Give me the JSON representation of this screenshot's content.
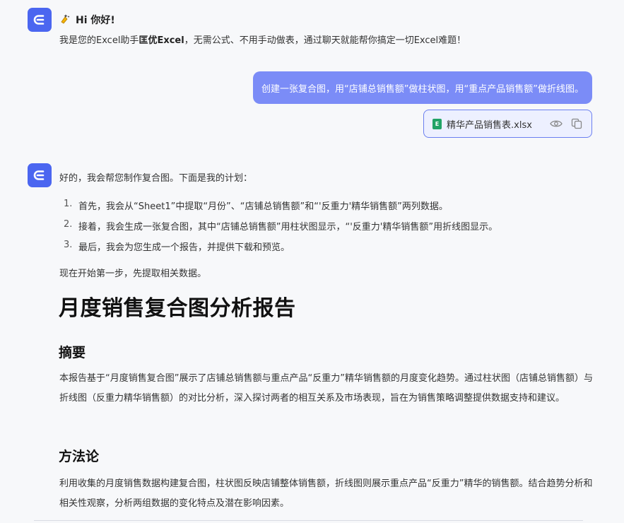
{
  "assistant": {
    "greeting_title": "Hi 你好!",
    "greeting_prefix": "我是您的Excel助手",
    "greeting_brand": "匡优Excel",
    "greeting_suffix": "，无需公式、不用手动做表，通过聊天就能帮你搞定一切Excel难题！",
    "logo_icon": "assistant-logo-icon",
    "wave_icon": "sparkle-hand-icon"
  },
  "user_message": {
    "text": "创建一张复合图，用“店铺总销售额”做柱状图，用“重点产品销售额”做折线图。",
    "attachment": {
      "file_name": "精华产品销售表.xlsx",
      "file_icon": "excel-file-icon",
      "badge": "E",
      "preview_icon": "eye-icon",
      "copy_icon": "copy-icon"
    }
  },
  "reply": {
    "intro": "好的，我会帮您制作复合图。下面是我的计划：",
    "plan": [
      {
        "num": "1.",
        "text": "首先，我会从“Sheet1”中提取“月份”、“店铺总销售额”和“'反重力'精华销售额”两列数据。"
      },
      {
        "num": "2.",
        "text": "接着，我会生成一张复合图，其中“店铺总销售额”用柱状图显示，“'反重力'精华销售额”用折线图显示。"
      },
      {
        "num": "3.",
        "text": "最后，我会为您生成一个报告，并提供下载和预览。"
      }
    ],
    "current_step": "现在开始第一步，先提取相关数据。"
  },
  "report": {
    "title": "月度销售复合图分析报告",
    "summary_heading": "摘要",
    "summary_text": "本报告基于“月度销售复合图”展示了店铺总销售额与重点产品“反重力”精华销售额的月度变化趋势。通过柱状图（店铺总销售额）与折线图（反重力精华销售额）的对比分析，深入探讨两者的相互关系及市场表现，旨在为销售策略调整提供数据支持和建议。",
    "method_heading": "方法论",
    "method_text": "利用收集的月度销售数据构建复合图，柱状图反映店铺整体销售额，折线图则展示重点产品“反重力”精华的销售额。结合趋势分析和相关性观察，分析两组数据的变化特点及潜在影响因素。"
  },
  "colors": {
    "brand": "#4b66f0",
    "user_bubble": "#7b8cf7",
    "excel_green": "#21a366"
  }
}
